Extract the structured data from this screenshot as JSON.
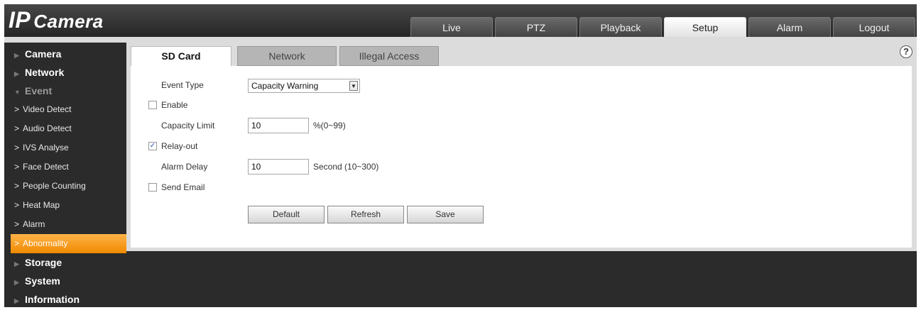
{
  "header": {
    "logo_ip": "IP",
    "logo_camera": "Camera",
    "nav": [
      "Live",
      "PTZ",
      "Playback",
      "Setup",
      "Alarm",
      "Logout"
    ],
    "active_nav": "Setup"
  },
  "sidebar": {
    "camera": "Camera",
    "network": "Network",
    "event": "Event",
    "event_items": [
      "Video Detect",
      "Audio Detect",
      "IVS Analyse",
      "Face Detect",
      "People Counting",
      "Heat Map",
      "Alarm",
      "Abnormality"
    ],
    "active_item": "Abnormality",
    "storage": "Storage",
    "system": "System",
    "information": "Information"
  },
  "tabs": [
    "SD Card",
    "Network",
    "Illegal Access"
  ],
  "active_tab": "SD Card",
  "help_icon": "?",
  "form": {
    "event_type_label": "Event Type",
    "event_type_value": "Capacity Warning",
    "enable_label": "Enable",
    "enable_checked": false,
    "capacity_limit_label": "Capacity Limit",
    "capacity_limit_value": "10",
    "capacity_limit_unit": "%(0~99)",
    "relay_out_label": "Relay-out",
    "relay_out_checked": true,
    "alarm_delay_label": "Alarm Delay",
    "alarm_delay_value": "10",
    "alarm_delay_unit": "Second (10~300)",
    "send_email_label": "Send Email",
    "send_email_checked": false
  },
  "buttons": {
    "default": "Default",
    "refresh": "Refresh",
    "save": "Save"
  },
  "check_mark": "✓",
  "colors": {
    "accent_orange": "#f5a623",
    "background_dark": "#2b2b2b",
    "panel_gray": "#dcdcdc"
  }
}
